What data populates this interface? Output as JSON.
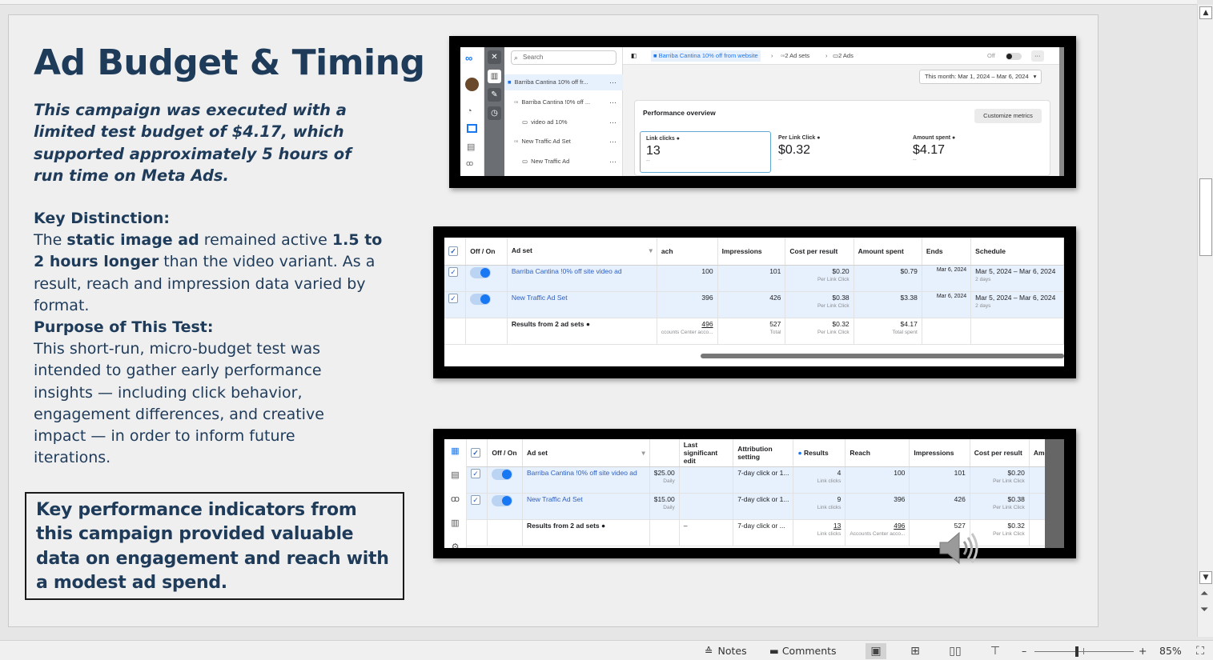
{
  "slide": {
    "title": "Ad Budget & Timing",
    "intro": "This campaign was executed with a limited test budget of $4.17, which supported approximately 5 hours of run time on Meta Ads.",
    "key_distinction_heading": "Key Distinction:",
    "kd_the": "The ",
    "kd_static": "static image ad",
    "kd_remained": " remained active ",
    "kd_hours": "1.5 to 2 hours longer",
    "kd_rest": " than the video variant. As a result, reach and impression data varied by format.",
    "purpose_heading": "Purpose of This Test:",
    "purpose_text": "This short-run, micro-budget test was intended to gather early performance insights — including click behavior, engagement differences, and creative impact — in order to inform future iterations.",
    "callout": "Key performance indicators from this campaign provided valuable data on engagement and reach with a modest ad spend."
  },
  "shot1": {
    "search_placeholder": "Search",
    "tree": [
      {
        "label": "Barriba Cantina 10% off fr...",
        "icon": "folder"
      },
      {
        "label": "Barriba Cantina !0% off ...",
        "icon": "adset"
      },
      {
        "label": "video ad 10%",
        "icon": "ad"
      },
      {
        "label": "New Traffic Ad Set",
        "icon": "adset"
      },
      {
        "label": "New Traffic Ad",
        "icon": "ad"
      }
    ],
    "breadcrumb_campaign": "Barriba Cantina 10% off from website",
    "breadcrumb_adsets": "2 Ad sets",
    "breadcrumb_ads": "2 Ads",
    "toggle_label": "Off",
    "date_range": "This month: Mar 1, 2024 – Mar 6, 2024",
    "perf_title": "Performance overview",
    "customize": "Customize metrics",
    "metrics": [
      {
        "label": "Link clicks",
        "value": "13",
        "delta": "--"
      },
      {
        "label": "Per Link Click",
        "value": "$0.32",
        "delta": "--"
      },
      {
        "label": "Amount spent",
        "value": "$4.17",
        "delta": "--"
      }
    ]
  },
  "shot2": {
    "headers": [
      "Off / On",
      "Ad set",
      "ach",
      "Impressions",
      "Cost per result",
      "Amount spent",
      "Ends",
      "Schedule"
    ],
    "rows": [
      {
        "name": "Barriba Cantina !0% off site video ad",
        "reach": "100",
        "impressions": "101",
        "cost": "$0.20",
        "cost_sub": "Per Link Click",
        "spent": "$0.79",
        "ends": "Mar 6, 2024",
        "schedule": "Mar 5, 2024 – Mar 6, 2024",
        "schedule_sub": "2 days"
      },
      {
        "name": "New Traffic Ad Set",
        "reach": "396",
        "impressions": "426",
        "cost": "$0.38",
        "cost_sub": "Per Link Click",
        "spent": "$3.38",
        "ends": "Mar 6, 2024",
        "schedule": "Mar 5, 2024 – Mar 6, 2024",
        "schedule_sub": "2 days"
      }
    ],
    "total": {
      "name": "Results from 2 ad sets",
      "reach": "496",
      "reach_sub": "ccounts Center acco...",
      "impressions": "527",
      "impressions_sub": "Total",
      "cost": "$0.32",
      "cost_sub": "Per Link Click",
      "spent": "$4.17",
      "spent_sub": "Total spent"
    }
  },
  "shot3": {
    "headers": [
      "Off / On",
      "Ad set",
      "",
      "Last significant edit",
      "Attribution setting",
      "Results",
      "Reach",
      "Impressions",
      "Cost per result",
      "Amount"
    ],
    "rows": [
      {
        "name": "Barriba Cantina !0% off site video ad",
        "budget": "$25.00",
        "budget_sub": "Daily",
        "attribution": "7-day click or 1...",
        "results": "4",
        "results_sub": "Link clicks",
        "reach": "100",
        "impressions": "101",
        "cost": "$0.20",
        "cost_sub": "Per Link Click"
      },
      {
        "name": "New Traffic Ad Set",
        "budget": "$15.00",
        "budget_sub": "Daily",
        "attribution": "7-day click or 1...",
        "results": "9",
        "results_sub": "Link clicks",
        "reach": "396",
        "impressions": "426",
        "cost": "$0.38",
        "cost_sub": "Per Link Click"
      }
    ],
    "total": {
      "name": "Results from 2 ad sets",
      "edit": "–",
      "attribution": "7-day click or ...",
      "results": "13",
      "results_sub": "Link clicks",
      "reach": "496",
      "reach_sub": "Accounts Center acco...",
      "impressions": "527",
      "cost": "$0.32",
      "cost_sub": "Per Link Click"
    }
  },
  "statusbar": {
    "notes": "Notes",
    "comments": "Comments",
    "zoom_minus": "–",
    "zoom_plus": "+",
    "zoom": "85%"
  },
  "colors": {
    "title": "#1f3b5a",
    "meta_blue": "#1877f2",
    "link_blue": "#2d5fbf"
  }
}
